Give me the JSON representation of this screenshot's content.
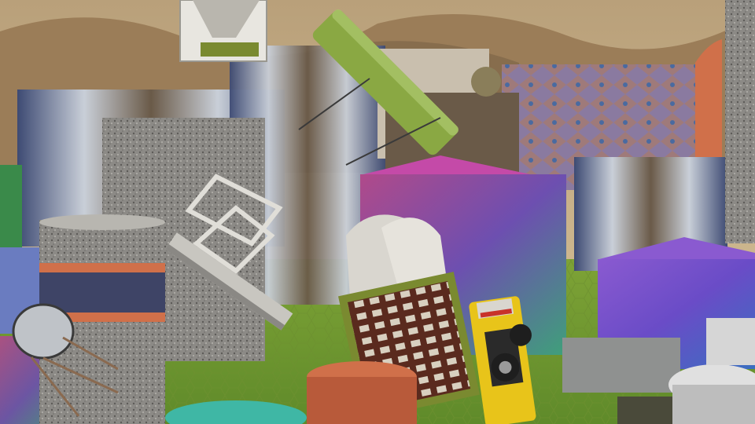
{
  "scene": {
    "kind": "synthetic-3d-render",
    "colors": {
      "sky_top": "#b9a07a",
      "sky_bottom": "#d8c49a",
      "mountain": "#9b7d58",
      "mountain_dark": "#7a6246",
      "ground": "#7ea336",
      "ground_dark": "#5f8a2a",
      "stone": "#8c8a86",
      "stone_dark": "#6b6965",
      "mirror_a": "#3d4a73",
      "mirror_b": "#c9cfd8",
      "mirror_c": "#6a5a48",
      "rainbow_a": "#6d4fb0",
      "rainbow_b": "#3fa07a",
      "rainbow_c": "#b04a8a",
      "orange": "#d0704a",
      "white_part": "#d9d6cf",
      "yellow_car": "#e8c41a",
      "teal_disc": "#3fb7a5",
      "purple_box": "#6a4cc7",
      "patterned_box": "#8a7aa0",
      "moss": "#7a8a30",
      "lime_tube": "#8aa843"
    }
  }
}
